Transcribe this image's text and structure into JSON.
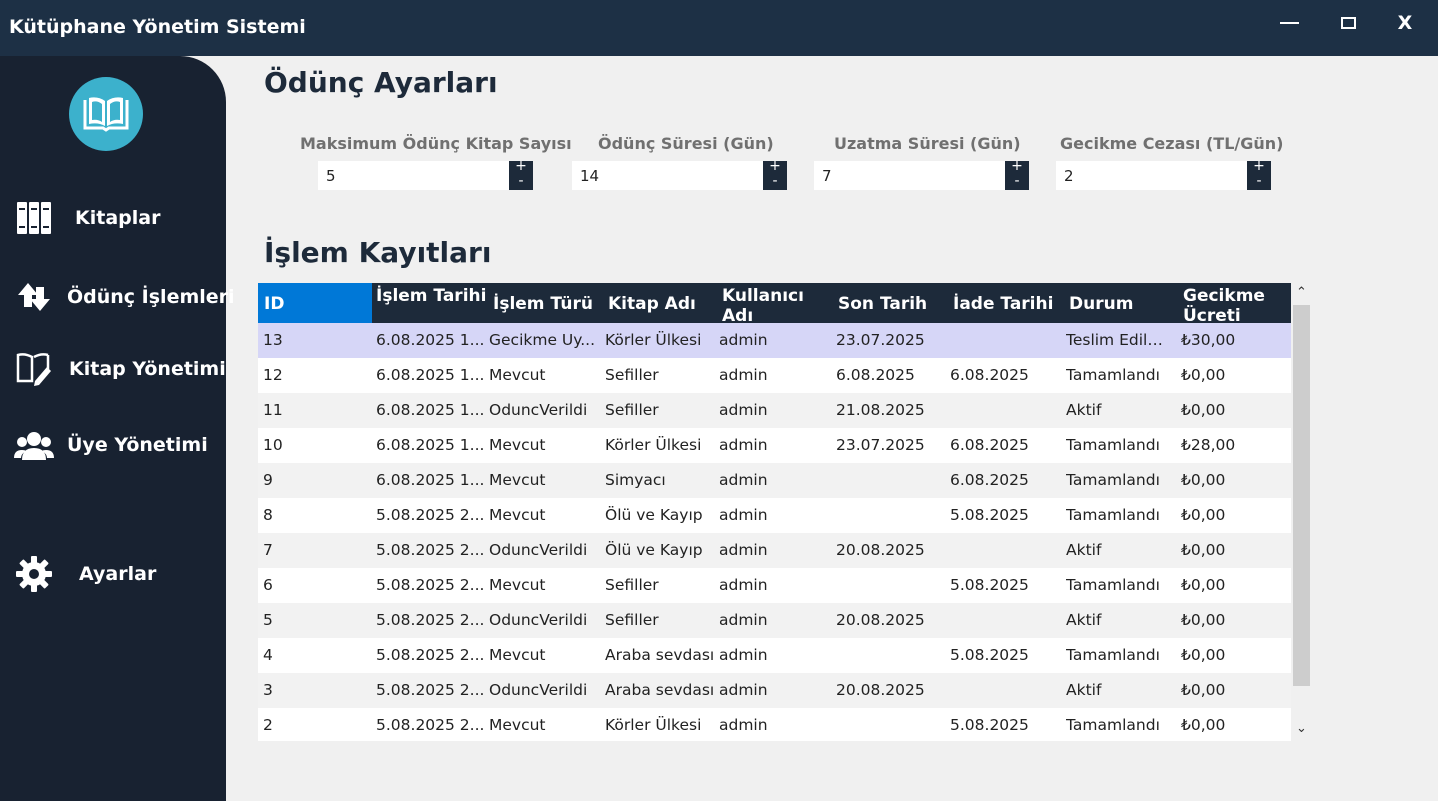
{
  "window": {
    "title": "Kütüphane Yönetim Sistemi",
    "minimize": "",
    "maximize": "",
    "close": "X"
  },
  "sidebar": {
    "items": [
      {
        "label": "Kitaplar",
        "icon": "books-icon"
      },
      {
        "label": "Ödünç İşlemleri",
        "icon": "exchange-arrows-icon"
      },
      {
        "label": "Kitap Yönetimi",
        "icon": "book-edit-icon"
      },
      {
        "label": "Üye Yönetimi",
        "icon": "users-icon"
      },
      {
        "label": "Ayarlar",
        "icon": "gear-icon"
      }
    ]
  },
  "settings": {
    "title": "Ödünç Ayarları",
    "fields": [
      {
        "label": "Maksimum Ödünç Kitap Sayısı",
        "value": "5"
      },
      {
        "label": "Ödünç Süresi (Gün)",
        "value": "14"
      },
      {
        "label": "Uzatma Süresi (Gün)",
        "value": "7"
      },
      {
        "label": "Gecikme Cezası (TL/Gün)",
        "value": "2"
      }
    ],
    "stepper_up": "+",
    "stepper_down": "-"
  },
  "records": {
    "title": "İşlem Kayıtları",
    "columns": [
      "ID",
      "İşlem Tarihi",
      "İşlem Türü",
      "Kitap Adı",
      "Kullanıcı Adı",
      "Son Tarih",
      "İade Tarihi",
      "Durum",
      "Gecikme Ücreti"
    ],
    "rows": [
      [
        "13",
        "6.08.2025 1...",
        "Gecikme Uy...",
        "Körler Ülkesi",
        "admin",
        "23.07.2025",
        "",
        "Teslim Edilm...",
        "₺30,00"
      ],
      [
        "12",
        "6.08.2025 1...",
        "Mevcut",
        "Sefiller",
        "admin",
        "6.08.2025",
        "6.08.2025",
        "Tamamlandı",
        "₺0,00"
      ],
      [
        "11",
        "6.08.2025 1...",
        "OduncVerildi",
        "Sefiller",
        "admin",
        "21.08.2025",
        "",
        "Aktif",
        "₺0,00"
      ],
      [
        "10",
        "6.08.2025 1...",
        "Mevcut",
        "Körler Ülkesi",
        "admin",
        "23.07.2025",
        "6.08.2025",
        "Tamamlandı",
        "₺28,00"
      ],
      [
        "9",
        "6.08.2025 1...",
        "Mevcut",
        "Simyacı",
        "admin",
        "",
        "6.08.2025",
        "Tamamlandı",
        "₺0,00"
      ],
      [
        "8",
        "5.08.2025 2...",
        "Mevcut",
        "Ölü ve Kayıp",
        "admin",
        "",
        "5.08.2025",
        "Tamamlandı",
        "₺0,00"
      ],
      [
        "7",
        "5.08.2025 2...",
        "OduncVerildi",
        "Ölü ve Kayıp",
        "admin",
        "20.08.2025",
        "",
        "Aktif",
        "₺0,00"
      ],
      [
        "6",
        "5.08.2025 2...",
        "Mevcut",
        "Sefiller",
        "admin",
        "",
        "5.08.2025",
        "Tamamlandı",
        "₺0,00"
      ],
      [
        "5",
        "5.08.2025 2...",
        "OduncVerildi",
        "Sefiller",
        "admin",
        "20.08.2025",
        "",
        "Aktif",
        "₺0,00"
      ],
      [
        "4",
        "5.08.2025 2...",
        "Mevcut",
        "Araba sevdası",
        "admin",
        "",
        "5.08.2025",
        "Tamamlandı",
        "₺0,00"
      ],
      [
        "3",
        "5.08.2025 2...",
        "OduncVerildi",
        "Araba sevdası",
        "admin",
        "20.08.2025",
        "",
        "Aktif",
        "₺0,00"
      ],
      [
        "2",
        "5.08.2025 2...",
        "Mevcut",
        "Körler Ülkesi",
        "admin",
        "",
        "5.08.2025",
        "Tamamlandı",
        "₺0,00"
      ]
    ],
    "selected_row": "13"
  },
  "colors": {
    "titlebar": "#1d3045",
    "sidebar": "#182231",
    "header": "#1d2a3a",
    "header_selected": "#0078d7",
    "selected_row": "#d6d6f7",
    "alt_row": "#f2f2f2",
    "logo": "#3cb1cc"
  },
  "scroll": {
    "up": "⌃",
    "down": "⌄"
  }
}
